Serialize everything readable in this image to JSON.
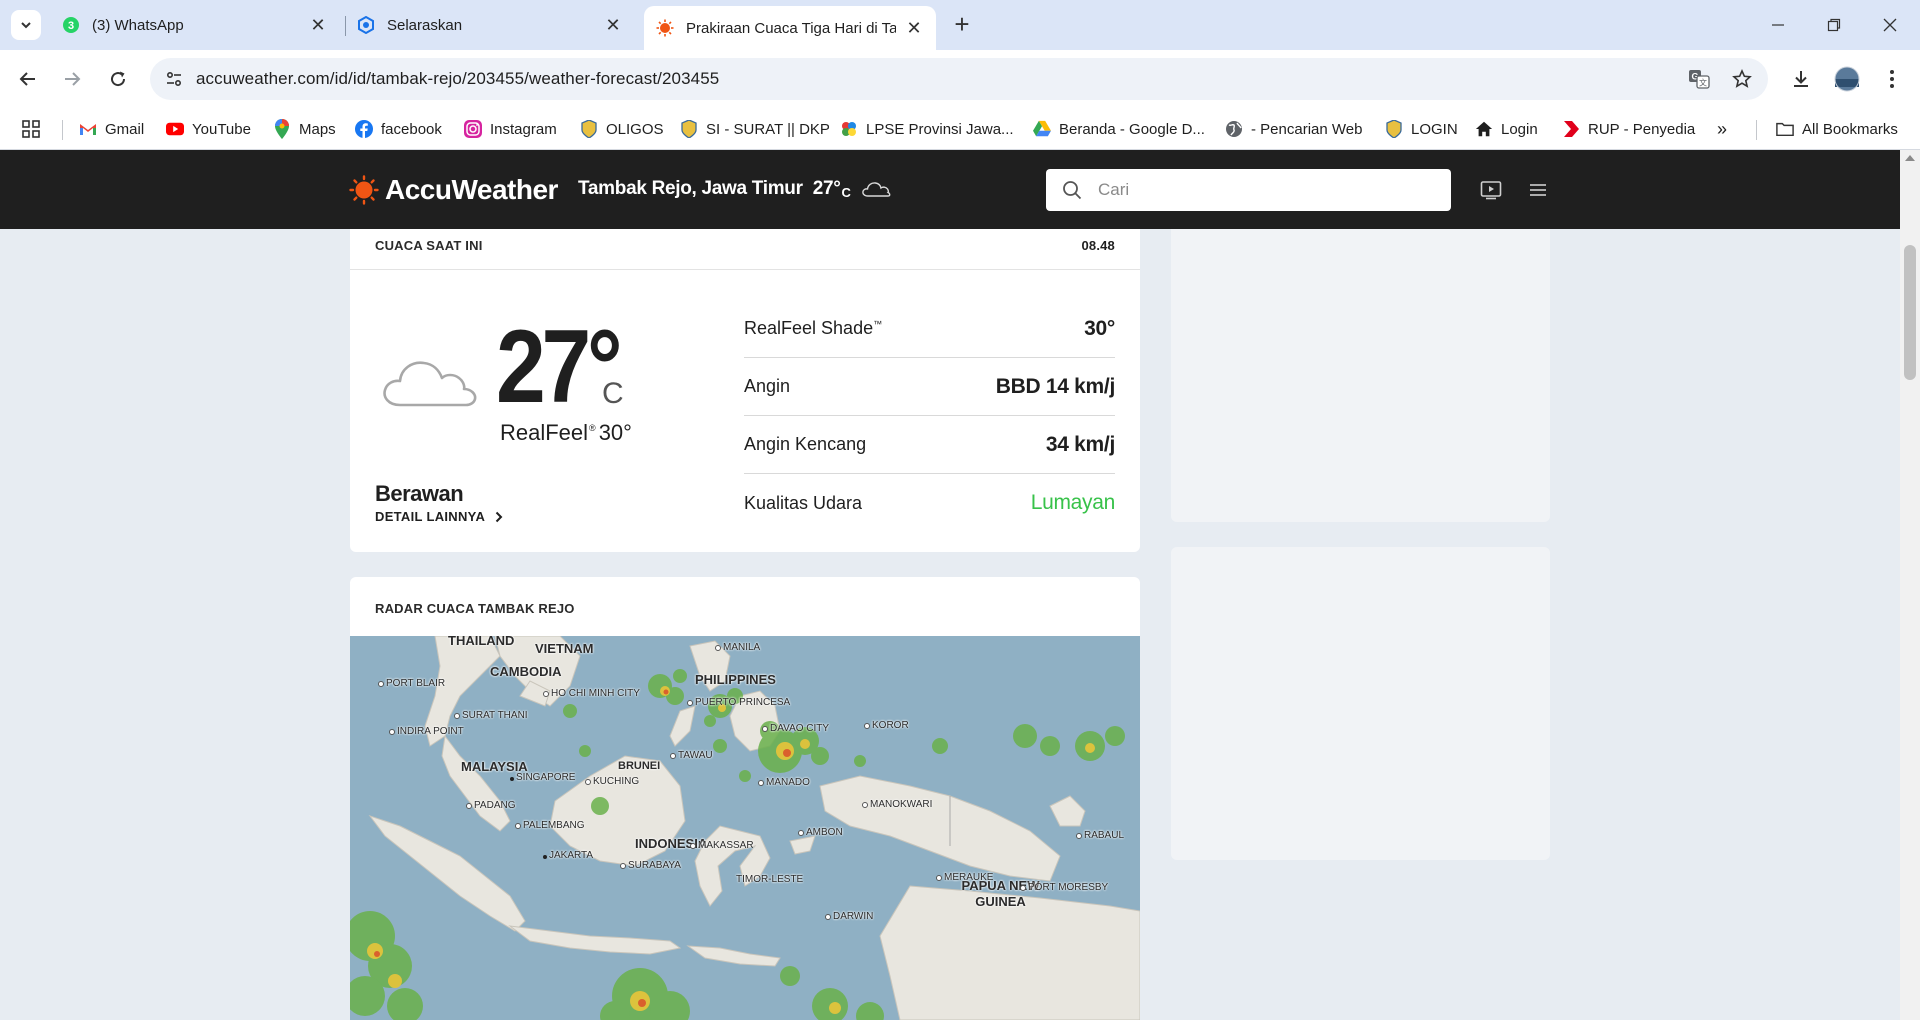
{
  "browser": {
    "tabs": [
      {
        "title": "(3) WhatsApp",
        "icon": "whatsapp-icon",
        "badge": "3"
      },
      {
        "title": "Selaraskan",
        "icon": "selaraskan-icon"
      },
      {
        "title": "Prakiraan Cuaca Tiga Hari di Tar",
        "icon": "accuweather-sun-icon",
        "active": true
      }
    ],
    "url": "accuweather.com/id/id/tambak-rejo/203455/weather-forecast/203455",
    "bookmarks": [
      {
        "label": "Gmail",
        "icon": "gmail-icon",
        "color": "#ea4335"
      },
      {
        "label": "YouTube",
        "icon": "youtube-icon",
        "color": "#ff0000"
      },
      {
        "label": "Maps",
        "icon": "maps-pin-icon",
        "color": "#34a853"
      },
      {
        "label": "facebook",
        "icon": "facebook-icon",
        "color": "#1877f2"
      },
      {
        "label": "Instagram",
        "icon": "instagram-icon",
        "color": "#e1306c"
      },
      {
        "label": "OLIGOS",
        "icon": "oligos-emblem-icon"
      },
      {
        "label": "SI - SURAT || DKP",
        "icon": "dkp-emblem-icon"
      },
      {
        "label": "LPSE Provinsi Jawa...",
        "icon": "lpse-icon"
      },
      {
        "label": "Beranda - Google D...",
        "icon": "google-drive-icon"
      },
      {
        "label": "- Pencarian Web",
        "icon": "globe-icon"
      },
      {
        "label": "LOGIN",
        "icon": "login-emblem-icon"
      },
      {
        "label": "Login",
        "icon": "home-icon"
      },
      {
        "label": "RUP - Penyedia",
        "icon": "rup-icon",
        "color": "#e0001b"
      }
    ],
    "all_bookmarks_label": "All Bookmarks"
  },
  "aw": {
    "brand": "AccuWeather",
    "brand_color": "#f05514",
    "location": "Tambak Rejo, Jawa Timur",
    "header_temp": "27°",
    "header_unit": "C",
    "search_placeholder": "Cari"
  },
  "current": {
    "label": "CUACA SAAT INI",
    "time": "08.48",
    "temp": "27°",
    "unit": "C",
    "realfeel_label": "RealFeel",
    "realfeel_tm": "®",
    "realfeel_value": "30°",
    "condition": "Berawan",
    "more_label": "DETAIL LAINNYA",
    "icon": "cloud-icon",
    "details": [
      {
        "label": "RealFeel Shade",
        "tm": "™",
        "value": "30°"
      },
      {
        "label": "Angin",
        "value": "BBD 14 km/j"
      },
      {
        "label": "Angin Kencang",
        "value": "34 km/j"
      },
      {
        "label": "Kualitas Udara",
        "value": "Lumayan",
        "color": "#38c24a"
      }
    ]
  },
  "radar": {
    "title": "RADAR CUACA TAMBAK REJO",
    "countries": [
      "THAILAND",
      "VIETNAM",
      "CAMBODIA",
      "PHILIPPINES",
      "MALAYSIA",
      "BRUNEI",
      "INDONESIA",
      "PAPUA NEW GUINEA"
    ],
    "cities": [
      "MANILA",
      "PORT BLAIR",
      "HO CHI MINH CITY",
      "PUERTO PRINCESA",
      "SURAT THANI",
      "DAVAO CITY",
      "KOROR",
      "INDIRA POINT",
      "TAWAU",
      "SINGAPORE",
      "KUCHING",
      "MANADO",
      "PADANG",
      "MANOKWARI",
      "PALEMBANG",
      "AMBON",
      "RABAUL",
      "MAKASSAR",
      "JAKARTA",
      "SURABAYA",
      "MERAUKE",
      "TIMOR-LESTE",
      "PORT MORESBY",
      "DARWIN"
    ]
  }
}
